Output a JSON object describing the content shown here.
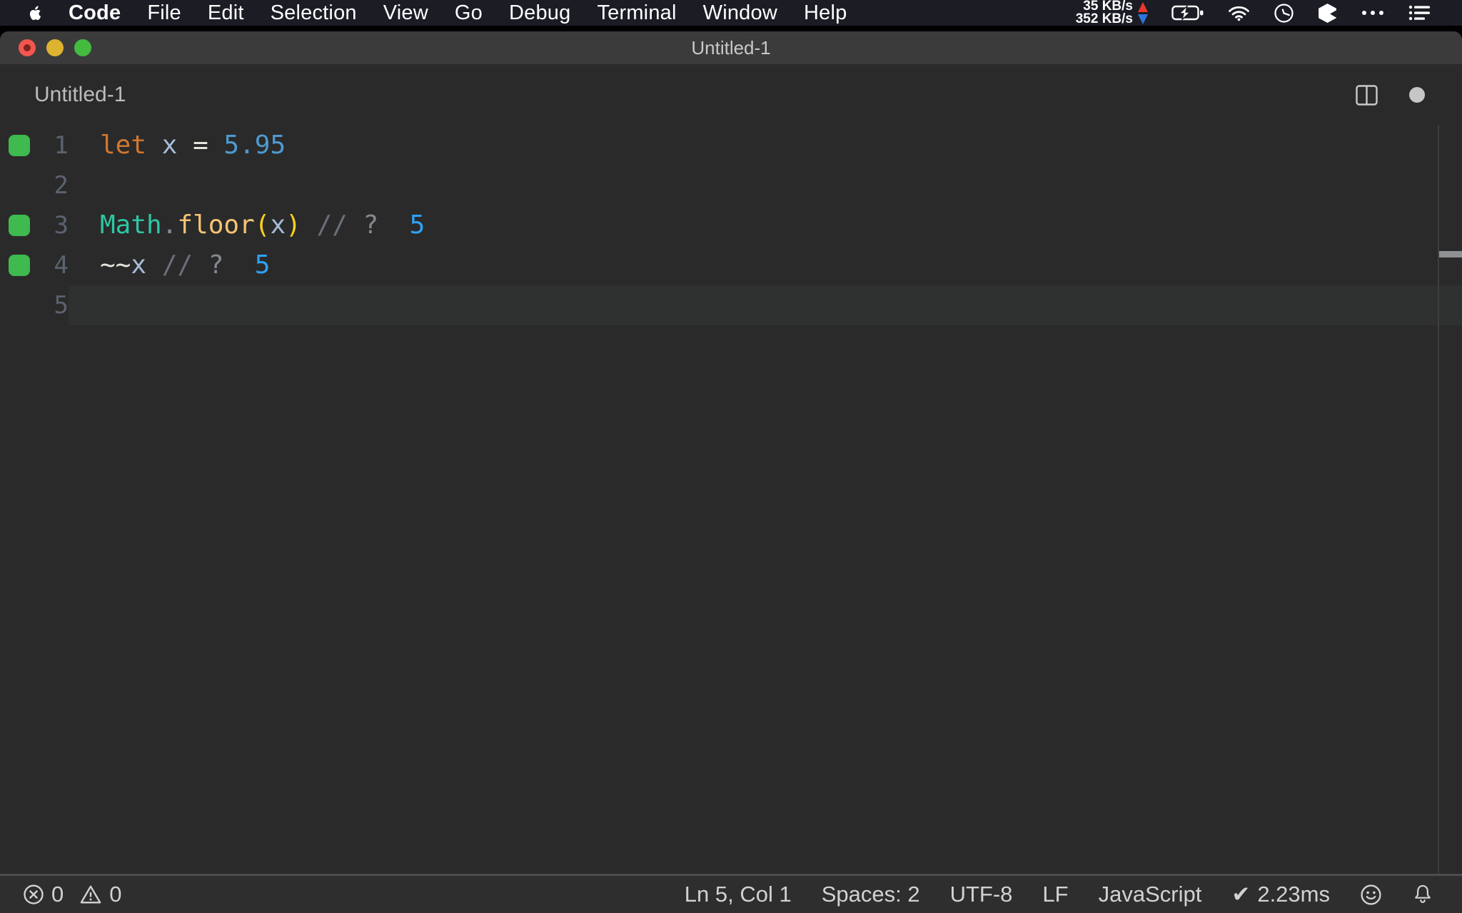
{
  "menubar": {
    "items": [
      "Code",
      "File",
      "Edit",
      "Selection",
      "View",
      "Go",
      "Debug",
      "Terminal",
      "Window",
      "Help"
    ],
    "network": {
      "up": "35 KB/s",
      "down": "352 KB/s"
    }
  },
  "window": {
    "titlebar": {
      "title": "Untitled-1"
    },
    "tab": {
      "label": "Untitled-1",
      "dirty": true
    }
  },
  "editor": {
    "lines": [
      {
        "num": "1",
        "marker": true,
        "current": false,
        "tokens": [
          {
            "text": "let",
            "color": "#d1772e"
          },
          {
            "text": " x ",
            "color": "#a6bdd6"
          },
          {
            "text": "= ",
            "color": "#e6e6df"
          },
          {
            "text": "5.95",
            "color": "#4f9ad0"
          }
        ]
      },
      {
        "num": "2",
        "marker": false,
        "current": false,
        "tokens": []
      },
      {
        "num": "3",
        "marker": true,
        "current": false,
        "tokens": [
          {
            "text": "Math",
            "color": "#2ec7a3"
          },
          {
            "text": ".",
            "color": "#7d8b99"
          },
          {
            "text": "floor",
            "color": "#f7c473"
          },
          {
            "text": "(",
            "color": "#ffd21c"
          },
          {
            "text": "x",
            "color": "#a6bdd6"
          },
          {
            "text": ")",
            "color": "#ffd21c"
          },
          {
            "text": " // ",
            "color": "#6a7077"
          },
          {
            "text": "?",
            "color": "#84898f"
          },
          {
            "text": "  5",
            "color": "#2fa2f2"
          }
        ]
      },
      {
        "num": "4",
        "marker": true,
        "current": false,
        "tokens": [
          {
            "text": "~~",
            "color": "#e6e6df"
          },
          {
            "text": "x",
            "color": "#a6bdd6"
          },
          {
            "text": " // ",
            "color": "#6a7077"
          },
          {
            "text": "?",
            "color": "#84898f"
          },
          {
            "text": "  5",
            "color": "#2fa2f2"
          }
        ]
      },
      {
        "num": "5",
        "marker": false,
        "current": true,
        "tokens": []
      }
    ]
  },
  "statusbar": {
    "errors": "0",
    "warnings": "0",
    "line_col": "Ln 5, Col 1",
    "indentation": "Spaces: 2",
    "encoding": "UTF-8",
    "eol": "LF",
    "language": "JavaScript",
    "check_glyph": "✔",
    "quokka_time": "2.23ms"
  },
  "icons": {
    "menubar": [
      "apple-logo",
      "battery-charging",
      "wifi",
      "clock",
      "cube-app",
      "ellipsis",
      "list-menu"
    ],
    "titlebar": [
      "close-traffic-light",
      "minimize-traffic-light",
      "zoom-traffic-light"
    ],
    "editor_header": [
      "split-editor",
      "dirty-dot"
    ],
    "statusbar": [
      "error-circle",
      "warning-triangle",
      "check",
      "smiley-feedback",
      "bell-notifications"
    ]
  },
  "colors": {
    "menubar_bg": "#1b1c24",
    "titlebar_bg": "#3b3b3c",
    "editor_bg": "#2a2a2b",
    "statusbar_bg": "#2e2e2f",
    "current_line_bg": "#2f3030",
    "quokka_marker_green": "#3eba4f",
    "traffic_red": "#f2564f",
    "traffic_yellow": "#ddb32f",
    "traffic_green": "#43ba40",
    "net_up_arrow": "#e8392b",
    "net_down_arrow": "#2f74d9"
  }
}
